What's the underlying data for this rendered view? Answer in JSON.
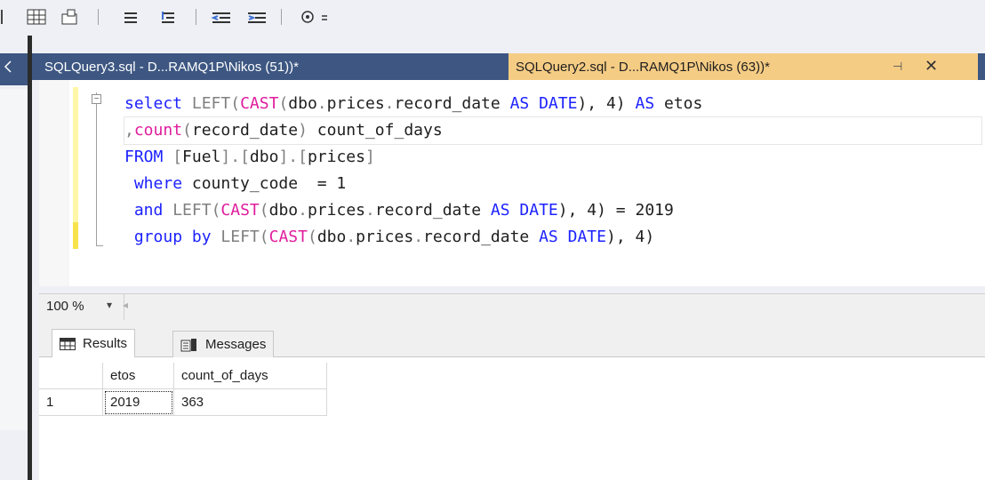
{
  "toolbar": {
    "buttons": [
      {
        "name": "results-to-grid-icon"
      },
      {
        "name": "results-to-file-icon"
      },
      {
        "name": "comment-lines-icon"
      },
      {
        "name": "uncomment-lines-icon"
      },
      {
        "name": "decrease-indent-icon"
      },
      {
        "name": "increase-indent-icon"
      },
      {
        "name": "specify-values-icon"
      }
    ]
  },
  "tabs": {
    "inactive_label": "SQLQuery3.sql - D...RAMQ1P\\Nikos (51))*",
    "active_label": "SQLQuery2.sql - D...RAMQ1P\\Nikos (63))*",
    "pin_glyph": "⊣",
    "close_glyph": "✕"
  },
  "editor": {
    "lines": [
      "select LEFT(CAST(dbo.prices.record_date AS DATE), 4) AS etos",
      ",count(record_date) count_of_days",
      "FROM [Fuel].[dbo].[prices]",
      " where county_code  = 1",
      " and LEFT(CAST(dbo.prices.record_date AS DATE), 4) = 2019",
      " group by LEFT(CAST(dbo.prices.record_date AS DATE), 4)"
    ],
    "fold_glyph": "−"
  },
  "zoom": {
    "value": "100 %",
    "dropdown_glyph": "▾",
    "scroll_glyph": "◂"
  },
  "results": {
    "tabs": [
      {
        "label": "Results",
        "icon": "grid-icon"
      },
      {
        "label": "Messages",
        "icon": "messages-icon"
      }
    ],
    "columns": [
      "etos",
      "count_of_days"
    ],
    "rows": [
      {
        "rownum": "1",
        "values": [
          "2019",
          "363"
        ]
      }
    ]
  },
  "colors": {
    "tab_bar": "#3d5782",
    "active_tab": "#f5cc84",
    "keyword": "#1c22ff",
    "function": "#e01d9e",
    "gray_function": "#808080"
  }
}
